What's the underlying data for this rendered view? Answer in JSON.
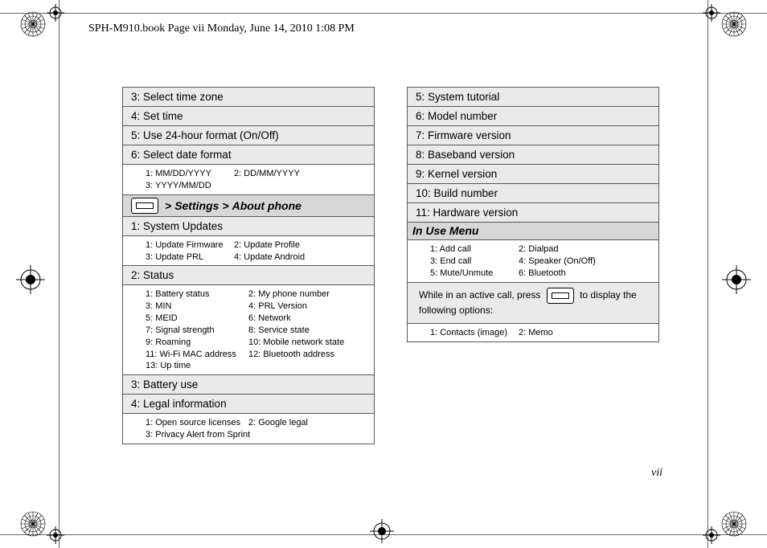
{
  "header": "SPH-M910.book  Page vii  Monday, June 14, 2010  1:08 PM",
  "page_number": "vii",
  "left": {
    "cells_top": [
      "3: Select time zone",
      "4: Set time",
      "5: Use 24-hour format (On/Off)",
      "6: Select date format"
    ],
    "date_formats": [
      [
        "1: MM/DD/YYYY",
        "2: DD/MM/YYYY"
      ],
      [
        "3: YYYY/MM/DD",
        ""
      ]
    ],
    "breadcrumb_pre": ">",
    "breadcrumb_a": "Settings",
    "breadcrumb_sep": ">",
    "breadcrumb_b": "About phone",
    "cell_sys_updates": "1: System Updates",
    "sys_updates": [
      [
        "1: Update Firmware",
        "2: Update Profile"
      ],
      [
        "3: Update PRL",
        "4: Update Android"
      ]
    ],
    "cell_status": "2: Status",
    "status": [
      [
        "1: Battery status",
        "2: My phone number"
      ],
      [
        "3: MIN",
        "4: PRL Version"
      ],
      [
        "5: MEID",
        "6: Network"
      ],
      [
        "7: Signal strength",
        "8: Service state"
      ],
      [
        "9: Roaming",
        "10: Mobile network state"
      ],
      [
        "11: Wi-Fi MAC address",
        "12: Bluetooth address"
      ],
      [
        "13: Up time",
        ""
      ]
    ],
    "cell_battery": "3: Battery use",
    "cell_legal": "4: Legal information",
    "legal": [
      [
        "1: Open source licenses",
        "2: Google legal"
      ],
      [
        "3: Privacy Alert from Sprint",
        ""
      ]
    ]
  },
  "right": {
    "cells": [
      "5: System tutorial",
      "6: Model number",
      "7: Firmware version",
      "8: Baseband version",
      "9: Kernel version",
      "10: Build number",
      "11: Hardware version"
    ],
    "menu_hdr": "In Use Menu",
    "in_use": [
      [
        "1: Add call",
        "2: Dialpad"
      ],
      [
        "3: End call",
        "4: Speaker (On/Off)"
      ],
      [
        "5: Mute/Unmute",
        "6: Bluetooth"
      ]
    ],
    "note_a": "While in an active call, press",
    "note_b": "to display the following options:",
    "contacts": [
      [
        "1: Contacts (image)",
        "2: Memo"
      ]
    ]
  }
}
